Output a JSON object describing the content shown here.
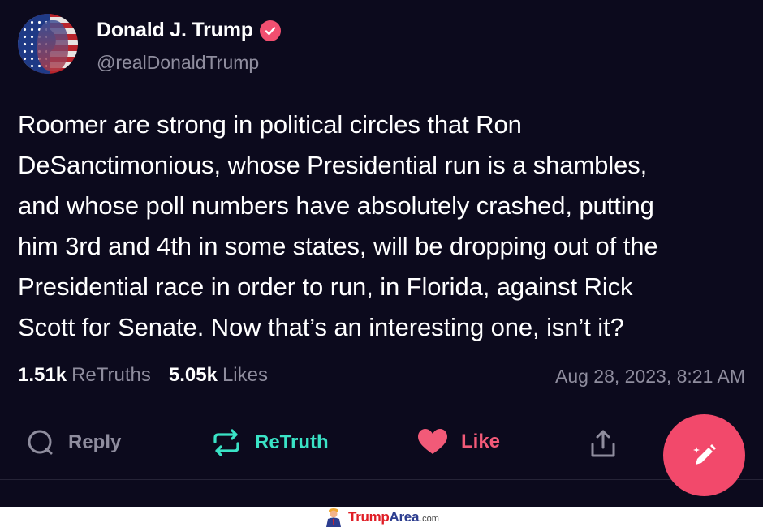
{
  "author": {
    "name": "Donald J. Trump",
    "handle": "@realDonaldTrump",
    "verified": true
  },
  "post": {
    "text": "Roomer are strong in political circles that Ron\nDeSanctimonious, whose Presidential run is a shambles,\nand whose poll numbers have absolutely crashed,   putting\nhim 3rd and 4th in some states, will be dropping out of the\nPresidential race in order to run, in Florida, against Rick\nScott for Senate. Now that’s an interesting one, isn’t it?",
    "timestamp": "Aug 28, 2023, 8:21 AM"
  },
  "stats": {
    "retruths_count": "1.51k",
    "retruths_label": "ReTruths",
    "likes_count": "5.05k",
    "likes_label": "Likes"
  },
  "actions": {
    "reply_label": "Reply",
    "retruth_label": "ReTruth",
    "like_label": "Like"
  },
  "icons": {
    "verified": "verified-badge-icon",
    "reply": "speech-bubble-icon",
    "retruth": "repost-arrows-icon",
    "like": "heart-icon",
    "share": "share-upload-icon",
    "compose": "pen-sparkle-icon"
  },
  "colors": {
    "background": "#0c0a1d",
    "accent": "#f2496b",
    "retruth": "#3ae3c6",
    "like": "#f25a78",
    "muted": "#8f8d9e"
  },
  "watermark": {
    "brand_part1": "Trump",
    "brand_part2": "Area",
    "brand_suffix": ".com"
  }
}
